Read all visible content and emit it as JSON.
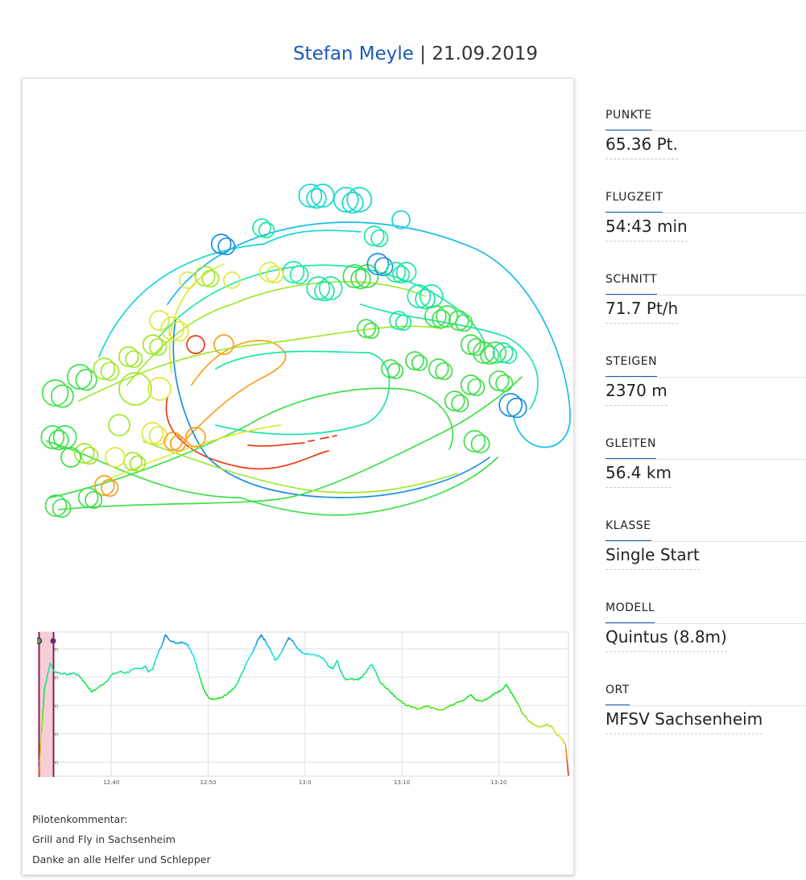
{
  "header": {
    "pilot": "Stefan Meyle",
    "separator": " | ",
    "date": "21.09.2019"
  },
  "stats": [
    {
      "label": "PUNKTE",
      "value": "65.36 Pt."
    },
    {
      "label": "FLUGZEIT",
      "value": "54:43 min"
    },
    {
      "label": "SCHNITT",
      "value": "71.7 Pt/h"
    },
    {
      "label": "STEIGEN",
      "value": "2370 m"
    },
    {
      "label": "GLEITEN",
      "value": "56.4 km"
    },
    {
      "label": "KLASSE",
      "value": "Single Start"
    },
    {
      "label": "MODELL",
      "value": "Quintus (8.8m)"
    },
    {
      "label": "ORT",
      "value": "MFSV Sachsenheim"
    }
  ],
  "comment": {
    "heading": "Pilotenkommentar:",
    "lines": [
      "Grill and Fly in Sachsenheim",
      "Danke an alle Helfer und Schlepper"
    ]
  },
  "chart_data": {
    "type": "line",
    "y_ticks": [
      "300m",
      "400m",
      "500m",
      "600m",
      "700m"
    ],
    "x_ticks": [
      "12:40",
      "12:50",
      "13:0",
      "13:10",
      "13:20"
    ],
    "ylim": [
      250,
      760
    ],
    "grid": true,
    "series": [
      {
        "points": [
          [
            0.0,
            250
          ],
          [
            0.6,
            560
          ],
          [
            1.2,
            650
          ],
          [
            1.6,
            620
          ],
          [
            2.2,
            615
          ],
          [
            3.0,
            610
          ],
          [
            3.6,
            615
          ],
          [
            4.2,
            605
          ],
          [
            4.9,
            575
          ],
          [
            5.5,
            548
          ],
          [
            6.2,
            565
          ],
          [
            7.0,
            585
          ],
          [
            7.6,
            610
          ],
          [
            8.4,
            620
          ],
          [
            9.0,
            615
          ],
          [
            9.8,
            628
          ],
          [
            10.6,
            630
          ],
          [
            11.0,
            640
          ],
          [
            11.3,
            620
          ],
          [
            11.8,
            630
          ],
          [
            12.2,
            675
          ],
          [
            12.8,
            720
          ],
          [
            13.1,
            750
          ],
          [
            13.6,
            730
          ],
          [
            14.2,
            720
          ],
          [
            14.8,
            725
          ],
          [
            15.4,
            715
          ],
          [
            16.0,
            675
          ],
          [
            16.6,
            605
          ],
          [
            17.0,
            560
          ],
          [
            17.5,
            530
          ],
          [
            18.0,
            522
          ],
          [
            18.7,
            526
          ],
          [
            19.4,
            538
          ],
          [
            20.0,
            555
          ],
          [
            20.5,
            575
          ],
          [
            21.0,
            615
          ],
          [
            21.6,
            660
          ],
          [
            22.2,
            695
          ],
          [
            22.6,
            730
          ],
          [
            23.0,
            750
          ],
          [
            23.4,
            728
          ],
          [
            23.9,
            700
          ],
          [
            24.4,
            660
          ],
          [
            24.8,
            672
          ],
          [
            25.3,
            705
          ],
          [
            25.8,
            740
          ],
          [
            26.3,
            725
          ],
          [
            26.8,
            700
          ],
          [
            27.3,
            685
          ],
          [
            28.0,
            682
          ],
          [
            28.8,
            675
          ],
          [
            29.4,
            668
          ],
          [
            29.9,
            640
          ],
          [
            30.4,
            630
          ],
          [
            30.8,
            660
          ],
          [
            31.2,
            620
          ],
          [
            31.7,
            590
          ],
          [
            32.4,
            595
          ],
          [
            33.0,
            590
          ],
          [
            33.5,
            605
          ],
          [
            34.0,
            630
          ],
          [
            34.4,
            645
          ],
          [
            34.8,
            620
          ],
          [
            35.3,
            580
          ],
          [
            36.0,
            560
          ],
          [
            36.8,
            532
          ],
          [
            37.6,
            508
          ],
          [
            38.4,
            495
          ],
          [
            39.2,
            488
          ],
          [
            40.0,
            498
          ],
          [
            40.8,
            490
          ],
          [
            41.6,
            485
          ],
          [
            42.4,
            497
          ],
          [
            43.2,
            512
          ],
          [
            44.0,
            522
          ],
          [
            44.6,
            538
          ],
          [
            45.1,
            520
          ],
          [
            45.8,
            515
          ],
          [
            46.6,
            530
          ],
          [
            47.2,
            545
          ],
          [
            47.8,
            555
          ],
          [
            48.3,
            575
          ],
          [
            48.8,
            545
          ],
          [
            49.4,
            510
          ],
          [
            50.0,
            470
          ],
          [
            50.6,
            445
          ],
          [
            51.2,
            430
          ],
          [
            51.8,
            425
          ],
          [
            52.4,
            432
          ],
          [
            53.0,
            425
          ],
          [
            53.4,
            400
          ],
          [
            53.8,
            390
          ],
          [
            54.1,
            380
          ],
          [
            54.4,
            360
          ],
          [
            54.7,
            253
          ]
        ]
      }
    ]
  }
}
